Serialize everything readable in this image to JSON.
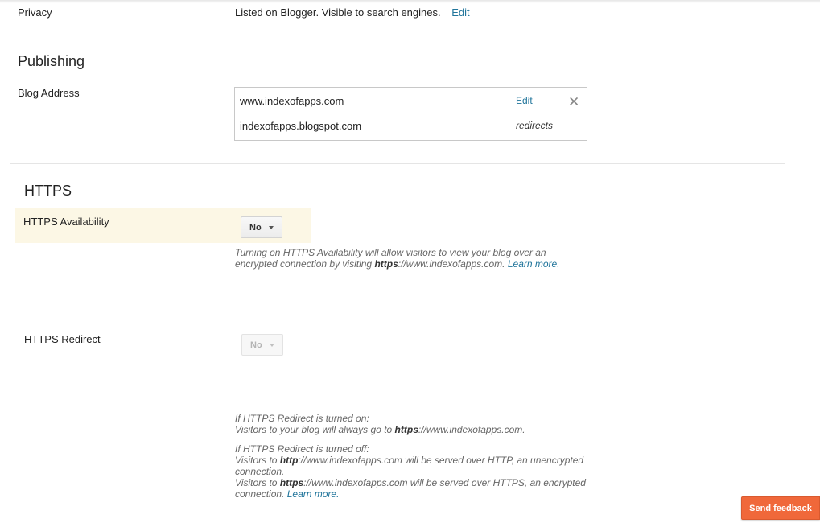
{
  "privacy": {
    "label": "Privacy",
    "value": "Listed on Blogger. Visible to search engines.",
    "edit_label": "Edit"
  },
  "publishing": {
    "title": "Publishing",
    "blog_address_label": "Blog Address",
    "primary_domain": "www.indexofapps.com",
    "edit_label": "Edit",
    "secondary_domain": "indexofapps.blogspot.com",
    "redirects_label": "redirects",
    "remove_icon": "close-icon"
  },
  "https": {
    "title": "HTTPS",
    "availability": {
      "label": "HTTPS Availability",
      "value": "No",
      "help_pre": "Turning on HTTPS Availability will allow visitors to view your blog over an encrypted connection by visiting ",
      "help_bold": "https",
      "help_url": "://www.indexofapps.com.",
      "learn_more": "Learn more."
    },
    "redirect": {
      "label": "HTTPS Redirect",
      "value": "No",
      "on_heading": "If HTTPS Redirect is turned on:",
      "on_pre": "Visitors to your blog will always go to ",
      "on_bold": "https",
      "on_url": "://www.indexofapps.com.",
      "off_heading": "If HTTPS Redirect is turned off:",
      "off_line1_pre": "Visitors to ",
      "off_line1_bold": "http",
      "off_line1_post": "://www.indexofapps.com will be served over HTTP, an unencrypted connection.",
      "off_line2_pre": "Visitors to ",
      "off_line2_bold": "https",
      "off_line2_post": "://www.indexofapps.com will be served over HTTPS, an encrypted connection.",
      "learn_more": "Learn more."
    }
  },
  "feedback": {
    "label": "Send feedback"
  },
  "colors": {
    "link": "#21759b",
    "highlight": "#fcf7e5",
    "feedback_button": "#f0683a"
  }
}
